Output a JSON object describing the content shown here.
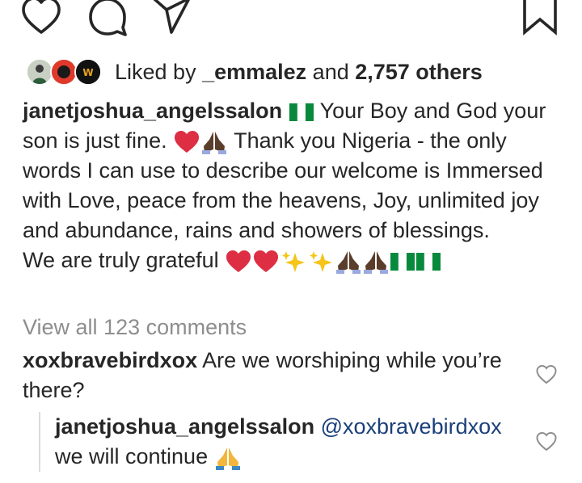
{
  "actions": {
    "like_icon": "heart-outline",
    "comment_icon": "speech-bubble",
    "share_icon": "paper-plane",
    "save_icon": "bookmark"
  },
  "likes": {
    "prefix": "Liked by ",
    "user": "_emmalez",
    "middle": " and ",
    "count": "2,757 others"
  },
  "caption": {
    "username": "janetjoshua_angelssalon",
    "line1": " Your Boy and God your son is just fine. ",
    "line2": " Thank you Nigeria - the only words I can use to describe our welcome is Immersed with Love, peace from the heavens, Joy, unlimited joy and abundance, rains and showers of blessings.",
    "line3": "We are truly grateful "
  },
  "view_all": "View all 123 comments",
  "comments": [
    {
      "username": "xoxbravebirdxox",
      "text": " Are we worshiping while you’re there?"
    }
  ],
  "reply": {
    "username": "janetjoshua_angelssalon",
    "mention": " @xoxbravebirdxox",
    "text": "we will continue "
  },
  "colors": {
    "text": "#262626",
    "muted": "#8e8e8e",
    "mention": "#1a3f7a",
    "heart_red": "#dd2e44",
    "nigeria_green": "#078a3c"
  }
}
